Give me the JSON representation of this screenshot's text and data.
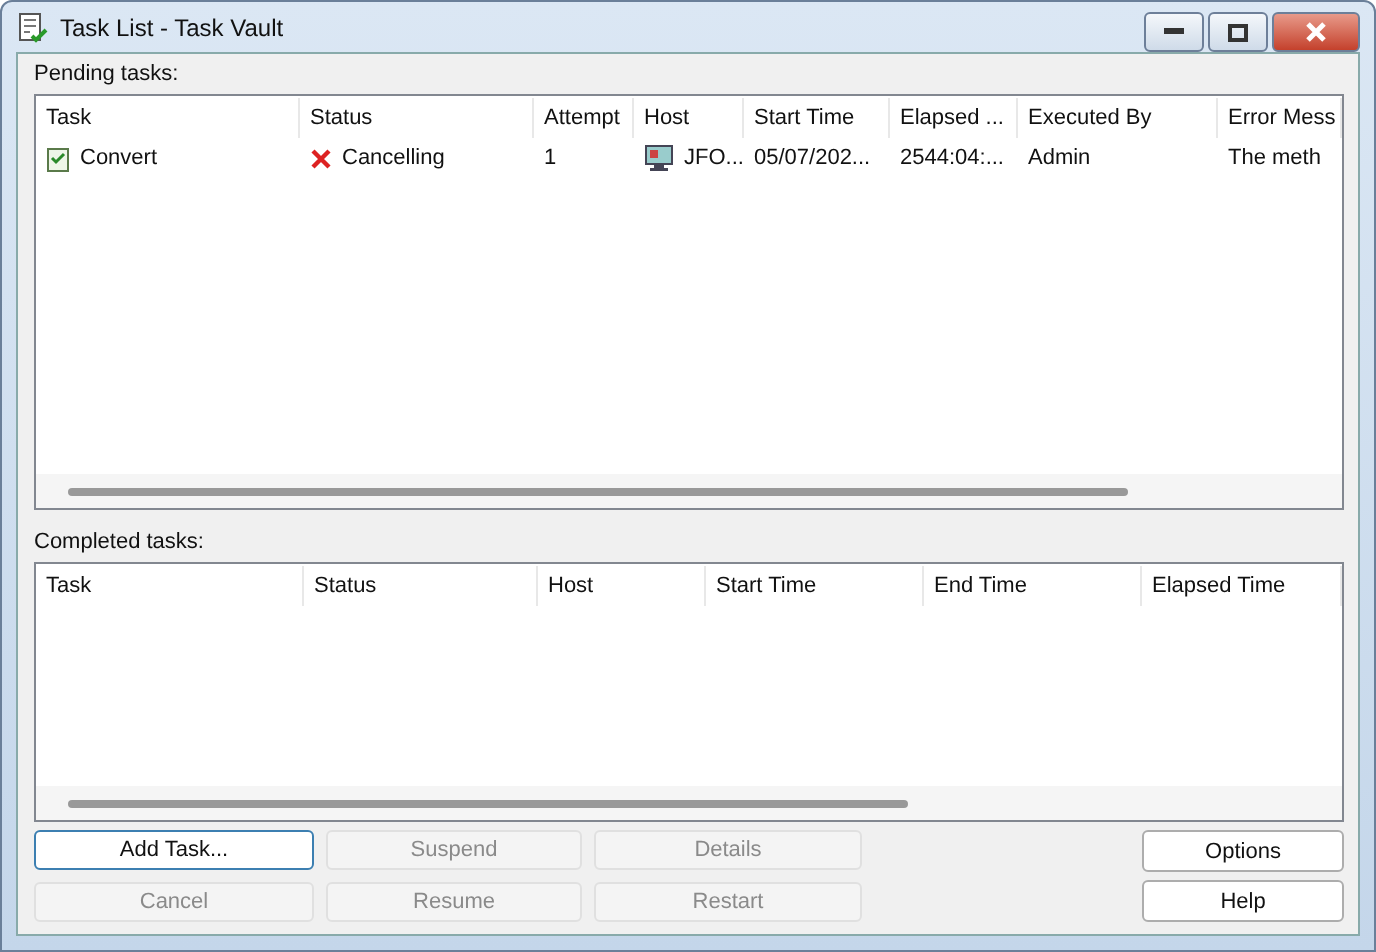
{
  "window": {
    "title": "Task List - Task Vault"
  },
  "pending": {
    "label": "Pending tasks:",
    "columns": [
      "Task",
      "Status",
      "Attempt",
      "Host",
      "Start Time",
      "Elapsed ...",
      "Executed By",
      "Error Mess"
    ],
    "rows": [
      {
        "cells": [
          "Convert",
          "Cancelling",
          "1",
          "JFO...",
          "05/07/202...",
          "2544:04:...",
          "Admin",
          "The meth"
        ]
      }
    ]
  },
  "completed": {
    "label": "Completed tasks:",
    "columns": [
      "Task",
      "Status",
      "Host",
      "Start Time",
      "End Time",
      "Elapsed Time"
    ]
  },
  "buttons": [
    {
      "label": "Add Task...",
      "disabled": false,
      "default": true
    },
    {
      "label": "Suspend",
      "disabled": true,
      "default": false
    },
    {
      "label": "Details",
      "disabled": true,
      "default": false
    },
    {
      "label": "Cancel",
      "disabled": true,
      "default": false
    },
    {
      "label": "Resume",
      "disabled": true,
      "default": false
    },
    {
      "label": "Restart",
      "disabled": true,
      "default": false
    }
  ],
  "side_buttons": [
    {
      "label": "Options",
      "disabled": false
    },
    {
      "label": "Help",
      "disabled": false
    }
  ]
}
